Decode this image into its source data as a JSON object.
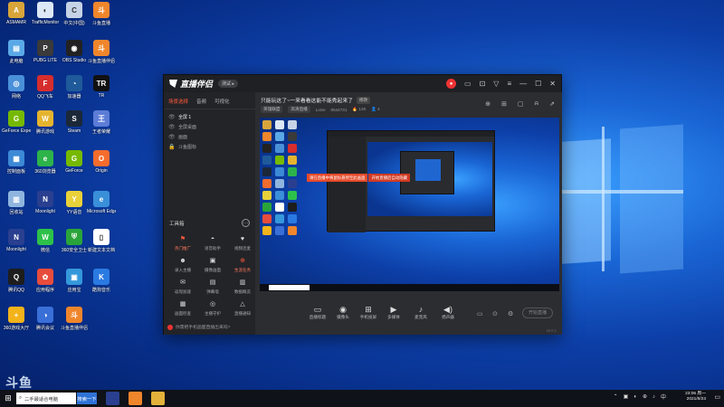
{
  "desktop": {
    "icons": [
      {
        "label": "ASMAMR",
        "color": "#d9a53a",
        "glyph": "A"
      },
      {
        "label": "TrafficMonitor",
        "color": "#dde8f6",
        "glyph": "◐"
      },
      {
        "label": "中文(中国)",
        "color": "#c6d3e6",
        "glyph": "C"
      },
      {
        "label": "斗鱼直播",
        "color": "#f0862c",
        "glyph": "斗"
      },
      {
        "label": "此电脑",
        "color": "#5aa9e6",
        "glyph": "▤"
      },
      {
        "label": "PUBG LITE",
        "color": "#3a3a3a",
        "glyph": "P"
      },
      {
        "label": "OBS Studio",
        "color": "#222",
        "glyph": "◉"
      },
      {
        "label": "斗鱼直播伴侣",
        "color": "#f0862c",
        "glyph": "斗"
      },
      {
        "label": "网络",
        "color": "#4a90d9",
        "glyph": "◎"
      },
      {
        "label": "QQ飞车",
        "color": "#d62d2d",
        "glyph": "F"
      },
      {
        "label": "加速器",
        "color": "#1f5a9a",
        "glyph": "◔"
      },
      {
        "label": "TR",
        "color": "#111",
        "glyph": "TR"
      },
      {
        "label": "GeForce Experience",
        "color": "#76b900",
        "glyph": "G"
      },
      {
        "label": "腾讯游戏",
        "color": "#e5b42f",
        "glyph": "W"
      },
      {
        "label": "Steam",
        "color": "#1b2838",
        "glyph": "S"
      },
      {
        "label": "王者荣耀",
        "color": "#5c7cd6",
        "glyph": "王"
      },
      {
        "label": "控制面板",
        "color": "#3c89d6",
        "glyph": "▦"
      },
      {
        "label": "360浏览器",
        "color": "#2db34a",
        "glyph": "e"
      },
      {
        "label": "GeForce",
        "color": "#76b900",
        "glyph": "G"
      },
      {
        "label": "Origin",
        "color": "#f56c2d",
        "glyph": "O"
      },
      {
        "label": "回收站",
        "color": "#8fb5df",
        "glyph": "▥"
      },
      {
        "label": "Moonlight",
        "color": "#2a3f8f",
        "glyph": "N"
      },
      {
        "label": "YY语音",
        "color": "#e9d13a",
        "glyph": "Y"
      },
      {
        "label": "Microsoft Edge",
        "color": "#3a8fd9",
        "glyph": "e"
      },
      {
        "label": "Moonlight",
        "color": "#2a3f8f",
        "glyph": "N"
      },
      {
        "label": "微信",
        "color": "#2dc14a",
        "glyph": "W"
      },
      {
        "label": "360安全卫士",
        "color": "#2aa43a",
        "glyph": "⛨"
      },
      {
        "label": "新建文本文档",
        "color": "#ffffff",
        "glyph": "▯"
      },
      {
        "label": "腾讯QQ",
        "color": "#1d1d1d",
        "glyph": "Q"
      },
      {
        "label": "应用程序",
        "color": "#e74c3c",
        "glyph": "✿"
      },
      {
        "label": "应用宝",
        "color": "#3498db",
        "glyph": "▣"
      },
      {
        "label": "酷狗音乐",
        "color": "#2a7ae2",
        "glyph": "K"
      },
      {
        "label": "360游戏大厅",
        "color": "#f3b31b",
        "glyph": "+"
      },
      {
        "label": "腾讯会议",
        "color": "#3a6fd8",
        "glyph": "◑"
      },
      {
        "label": "斗鱼直播伴侣",
        "color": "#f0862c",
        "glyph": "斗"
      }
    ]
  },
  "app": {
    "name": "直播伴侣",
    "beta": "测试 ▸",
    "title_icons": [
      "●",
      "▭",
      "⊡",
      "▽",
      "≡",
      "—",
      "☐",
      "✕"
    ],
    "sidebar": {
      "tabs": [
        "场景选择",
        "音频",
        "可视化"
      ],
      "scenes": [
        {
          "eye": "👁",
          "label": "全屏 1"
        },
        {
          "eye": "👁",
          "label": "全屏桌面"
        },
        {
          "eye": "👁",
          "label": "画面"
        },
        {
          "eye": "🔒",
          "label": "斗鱼图标"
        }
      ],
      "toolbox_title": "工具箱",
      "tools": [
        {
          "icon": "⚑",
          "label": "热门推广",
          "hot": true
        },
        {
          "icon": "◓",
          "label": "语音助手",
          "hot": false
        },
        {
          "icon": "♥",
          "label": "视频连麦",
          "hot": false
        },
        {
          "icon": "☻",
          "label": "录入主播",
          "hot": false
        },
        {
          "icon": "▣",
          "label": "摄像画面",
          "hot": false
        },
        {
          "icon": "⊕",
          "label": "生涯任务",
          "hot": true
        },
        {
          "icon": "✉",
          "label": "返现加速",
          "hot": false
        },
        {
          "icon": "▤",
          "label": "弹幕墙",
          "hot": false
        },
        {
          "icon": "▥",
          "label": "数据概览",
          "hot": false
        },
        {
          "icon": "▦",
          "label": "画面检查",
          "hot": false
        },
        {
          "icon": "◎",
          "label": "主播守护",
          "hot": false
        },
        {
          "icon": "△",
          "label": "直播通知",
          "hot": false
        }
      ],
      "notice": "你需把手机画面直播出来吗?"
    },
    "room": {
      "title": "只能玩这了~一来看看这能不能秀起来了",
      "edit": "修改",
      "category": "英雄联盟",
      "mode": "高清直播",
      "streamer": "LoSe",
      "room_id": "8544731",
      "hot": "🔥 126",
      "viewers": "👤 4",
      "right_icons": [
        "⊕",
        "⊞",
        "▢",
        "⍾",
        "⇗"
      ]
    },
    "preview_overlay": {
      "left": "请在直播中将鼠标悬停至此画面",
      "right": "开始直播后自动隐藏"
    },
    "controls": [
      {
        "icon": "▭",
        "label": "直播标题"
      },
      {
        "icon": "◉",
        "label": "摄像头"
      },
      {
        "icon": "⊞",
        "label": "手机投屏"
      },
      {
        "icon": "▶",
        "label": "多媒体"
      },
      {
        "icon": "♪",
        "label": "麦克风"
      },
      {
        "icon": "◀)",
        "label": "扬声器"
      }
    ],
    "control_extra": [
      "▭",
      "⊙",
      "⚙"
    ],
    "live_button": "开始直播",
    "version": "v5.0.1"
  },
  "watermark": {
    "brand": "斗鱼",
    "sub": "DOUYU.COM"
  },
  "taskbar": {
    "start": "⊞",
    "search_text": "二手最适合电脑",
    "search_button": "搜索一下",
    "apps": [
      {
        "color": "#2a3f8f"
      },
      {
        "color": "#f0862c"
      },
      {
        "color": "#e2b23a"
      }
    ],
    "tray": [
      "⌃",
      "▣",
      "◐",
      "⊕",
      "♪",
      "中"
    ],
    "time": "23:06 周一",
    "date": "2021/8/23"
  }
}
